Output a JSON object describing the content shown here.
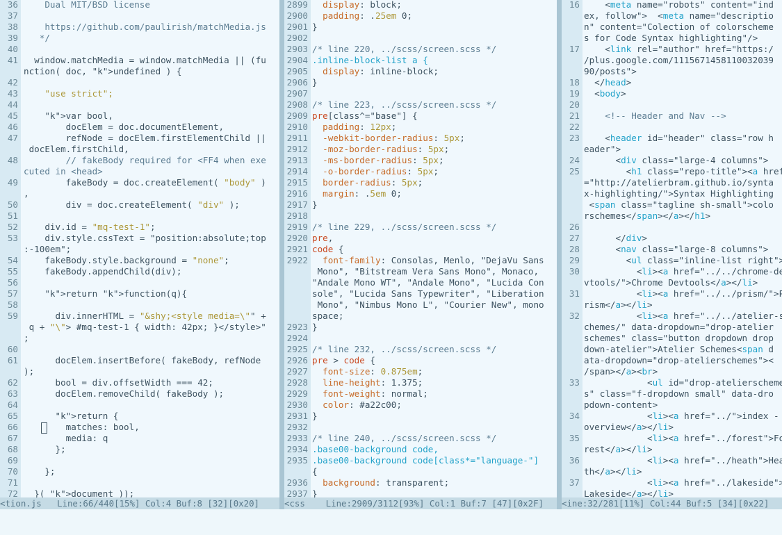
{
  "panes": [
    {
      "name": "matchmedia-js",
      "lines": [
        {
          "n": "36",
          "t": "    Dual MIT/BSD license",
          "c": "c"
        },
        {
          "n": "37",
          "t": ""
        },
        {
          "n": "38",
          "t": "    https://github.com/paulirish/matchMedia.js",
          "c": "c"
        },
        {
          "n": "39",
          "t": "   */",
          "c": "c"
        },
        {
          "n": "40",
          "t": ""
        },
        {
          "n": "41",
          "t": "  window.matchMedia = window.matchMedia || (fu"
        },
        {
          "n": "",
          "t": "nction( doc, undefined ) {"
        },
        {
          "n": "42",
          "t": ""
        },
        {
          "n": "43",
          "t": "    \"use strict\";",
          "c": "s"
        },
        {
          "n": "44",
          "t": ""
        },
        {
          "n": "45",
          "t": "    var bool,"
        },
        {
          "n": "46",
          "t": "        docElem = doc.documentElement,"
        },
        {
          "n": "47",
          "t": "        refNode = docElem.firstElementChild ||"
        },
        {
          "n": "",
          "t": " docElem.firstChild,"
        },
        {
          "n": "48",
          "t": "        // fakeBody required for <FF4 when exe",
          "c": "c"
        },
        {
          "n": "",
          "t": "cuted in <head>",
          "c": "c"
        },
        {
          "n": "49",
          "t": "        fakeBody = doc.createElement( \"body\" )"
        },
        {
          "n": "",
          "t": ","
        },
        {
          "n": "50",
          "t": "        div = doc.createElement( \"div\" );"
        },
        {
          "n": "51",
          "t": ""
        },
        {
          "n": "52",
          "t": "    div.id = \"mq-test-1\";"
        },
        {
          "n": "53",
          "t": "    div.style.cssText = \"position:absolute;top"
        },
        {
          "n": "",
          "t": ":-100em\";"
        },
        {
          "n": "54",
          "t": "    fakeBody.style.background = \"none\";"
        },
        {
          "n": "55",
          "t": "    fakeBody.appendChild(div);"
        },
        {
          "n": "56",
          "t": ""
        },
        {
          "n": "57",
          "t": "    return function(q){"
        },
        {
          "n": "58",
          "t": ""
        },
        {
          "n": "59",
          "t": "      div.innerHTML = \"&shy;<style media=\\\"\" +"
        },
        {
          "n": "",
          "t": " q + \"\\\"> #mq-test-1 { width: 42px; }</style>\""
        },
        {
          "n": "",
          "t": ";"
        },
        {
          "n": "60",
          "t": ""
        },
        {
          "n": "61",
          "t": "      docElem.insertBefore( fakeBody, refNode"
        },
        {
          "n": "",
          "t": ");"
        },
        {
          "n": "62",
          "t": "      bool = div.offsetWidth === 42;"
        },
        {
          "n": "63",
          "t": "      docElem.removeChild( fakeBody );"
        },
        {
          "n": "64",
          "t": ""
        },
        {
          "n": "65",
          "t": "      return {"
        },
        {
          "n": "66",
          "t": "        matches: bool,",
          "cursor": true
        },
        {
          "n": "67",
          "t": "        media: q"
        },
        {
          "n": "68",
          "t": "      };"
        },
        {
          "n": "69",
          "t": ""
        },
        {
          "n": "70",
          "t": "    };"
        },
        {
          "n": "71",
          "t": ""
        },
        {
          "n": "72",
          "t": "  }( document ));"
        }
      ],
      "status": "<tion.js   Line:66/440[15%] Col:4 Buf:8 [32][0x20]"
    },
    {
      "name": "screen-css",
      "lines": [
        {
          "n": "2899",
          "t": "  display: block;"
        },
        {
          "n": "2900",
          "t": "  padding: .25em 0;"
        },
        {
          "n": "2901",
          "t": "}"
        },
        {
          "n": "2902",
          "t": ""
        },
        {
          "n": "2903",
          "t": "/* line 220, ../scss/screen.scss */",
          "c": "c"
        },
        {
          "n": "2904",
          "t": ".inline-block-list a {",
          "c": "sel"
        },
        {
          "n": "2905",
          "t": "  display: inline-block;"
        },
        {
          "n": "2906",
          "t": "}"
        },
        {
          "n": "2907",
          "t": ""
        },
        {
          "n": "2908",
          "t": "/* line 223, ../scss/screen.scss */",
          "c": "c"
        },
        {
          "n": "2909",
          "t": "pre[class^=\"base\"] {"
        },
        {
          "n": "2910",
          "t": "  padding: 12px;"
        },
        {
          "n": "2911",
          "t": "  -webkit-border-radius: 5px;"
        },
        {
          "n": "2912",
          "t": "  -moz-border-radius: 5px;"
        },
        {
          "n": "2913",
          "t": "  -ms-border-radius: 5px;"
        },
        {
          "n": "2914",
          "t": "  -o-border-radius: 5px;"
        },
        {
          "n": "2915",
          "t": "  border-radius: 5px;"
        },
        {
          "n": "2916",
          "t": "  margin: .5em 0;"
        },
        {
          "n": "2917",
          "t": "}"
        },
        {
          "n": "2918",
          "t": ""
        },
        {
          "n": "2919",
          "t": "/* line 229, ../scss/screen.scss */",
          "c": "c"
        },
        {
          "n": "2920",
          "t": "pre,"
        },
        {
          "n": "2921",
          "t": "code {"
        },
        {
          "n": "2922",
          "t": "  font-family: Consolas, Menlo, \"DejaVu Sans"
        },
        {
          "n": "",
          "t": " Mono\", \"Bitstream Vera Sans Mono\", Monaco,"
        },
        {
          "n": "",
          "t": "\"Andale Mono WT\", \"Andale Mono\", \"Lucida Con"
        },
        {
          "n": "",
          "t": "sole\", \"Lucida Sans Typewriter\", \"Liberation"
        },
        {
          "n": "",
          "t": " Mono\", \"Nimbus Mono L\", \"Courier New\", mono"
        },
        {
          "n": "",
          "t": "space;"
        },
        {
          "n": "2923",
          "t": "}"
        },
        {
          "n": "2924",
          "t": ""
        },
        {
          "n": "2925",
          "t": "/* line 232, ../scss/screen.scss */",
          "c": "c"
        },
        {
          "n": "2926",
          "t": "pre > code {"
        },
        {
          "n": "2927",
          "t": "  font-size: 0.875em;"
        },
        {
          "n": "2928",
          "t": "  line-height: 1.375;"
        },
        {
          "n": "2929",
          "t": "  font-weight: normal;"
        },
        {
          "n": "2930",
          "t": "  color: #a22c00;"
        },
        {
          "n": "2931",
          "t": "}"
        },
        {
          "n": "2932",
          "t": ""
        },
        {
          "n": "2933",
          "t": "/* line 240, ../scss/screen.scss */",
          "c": "c"
        },
        {
          "n": "2934",
          "t": ".base00-background code,",
          "c": "sel"
        },
        {
          "n": "2935",
          "t": ".base00-background code[class*=\"language-\"]",
          "c": "sel"
        },
        {
          "n": "",
          "t": "{"
        },
        {
          "n": "2936",
          "t": "  background: transparent;"
        },
        {
          "n": "2937",
          "t": "}"
        }
      ],
      "status": "<css    Line:2909/3112[93%] Col:1 Buf:7 [47][0x2F]"
    },
    {
      "name": "index-html",
      "lines": [
        {
          "n": "16",
          "t": "    <meta name=\"robots\" content=\"ind"
        },
        {
          "n": "",
          "t": "ex, follow\">  <meta name=\"descriptio"
        },
        {
          "n": "",
          "t": "n\" content=\"Colection of colorscheme"
        },
        {
          "n": "",
          "t": "s for Code Syntax highlighting\"/>"
        },
        {
          "n": "17",
          "t": "    <link rel=\"author\" href=\"https:/"
        },
        {
          "n": "",
          "t": "/plus.google.com/1115671458110032039"
        },
        {
          "n": "",
          "t": "90/posts\">"
        },
        {
          "n": "18",
          "t": "  </head>"
        },
        {
          "n": "19",
          "t": "  <body>"
        },
        {
          "n": "20",
          "t": ""
        },
        {
          "n": "21",
          "t": "    <!-- Header and Nav -->",
          "c": "c"
        },
        {
          "n": "22",
          "t": ""
        },
        {
          "n": "23",
          "t": "    <header id=\"header\" class=\"row h"
        },
        {
          "n": "",
          "t": "eader\">"
        },
        {
          "n": "24",
          "t": "      <div class=\"large-4 columns\">"
        },
        {
          "n": "25",
          "t": "        <h1 class=\"repo-title\"><a href"
        },
        {
          "n": "",
          "t": "=\"http://atelierbram.github.io/synta"
        },
        {
          "n": "",
          "t": "x-highlighting/\">Syntax Highlighting"
        },
        {
          "n": "",
          "t": " <span class=\"tagline sh-small\">colo"
        },
        {
          "n": "",
          "t": "rschemes</span></a></h1>"
        },
        {
          "n": "26",
          "t": ""
        },
        {
          "n": "27",
          "t": "      </div>"
        },
        {
          "n": "28",
          "t": "      <nav class=\"large-8 columns\">"
        },
        {
          "n": "29",
          "t": "        <ul class=\"inline-list right\">"
        },
        {
          "n": "30",
          "t": "          <li><a href=\"../../chrome-de"
        },
        {
          "n": "",
          "t": "vtools/\">Chrome Devtools</a></li>"
        },
        {
          "n": "31",
          "t": "          <li><a href=\"../../prism/\">P"
        },
        {
          "n": "",
          "t": "rism</a></li>"
        },
        {
          "n": "32",
          "t": "          <li><a href=\"../../atelier-s"
        },
        {
          "n": "",
          "t": "chemes/\" data-dropdown=\"drop-atelier"
        },
        {
          "n": "",
          "t": "schemes\" class=\"button dropdown drop"
        },
        {
          "n": "",
          "t": "down-atelier\">Atelier Schemes<span d"
        },
        {
          "n": "",
          "t": "ata-dropdown=\"drop-atelierschemes\"><"
        },
        {
          "n": "",
          "t": "/span></a><br>"
        },
        {
          "n": "33",
          "t": "            <ul id=\"drop-atelierscheme"
        },
        {
          "n": "",
          "t": "s\" class=\"f-dropdown small\" data-dro"
        },
        {
          "n": "",
          "t": "pdown-content>"
        },
        {
          "n": "34",
          "t": "            <li><a href=\"../\">index -"
        },
        {
          "n": "",
          "t": "overview</a></li>"
        },
        {
          "n": "35",
          "t": "            <li><a href=\"../forest\">Fo"
        },
        {
          "n": "",
          "t": "rest</a></li>"
        },
        {
          "n": "36",
          "t": "            <li><a href=\"../heath\">Hea"
        },
        {
          "n": "",
          "t": "th</a></li>"
        },
        {
          "n": "37",
          "t": "            <li><a href=\"../lakeside\">"
        },
        {
          "n": "",
          "t": "Lakeside</a></li>"
        }
      ],
      "status": "<ine:32/281[11%] Col:44 Buf:5 [34][0x22]"
    }
  ]
}
